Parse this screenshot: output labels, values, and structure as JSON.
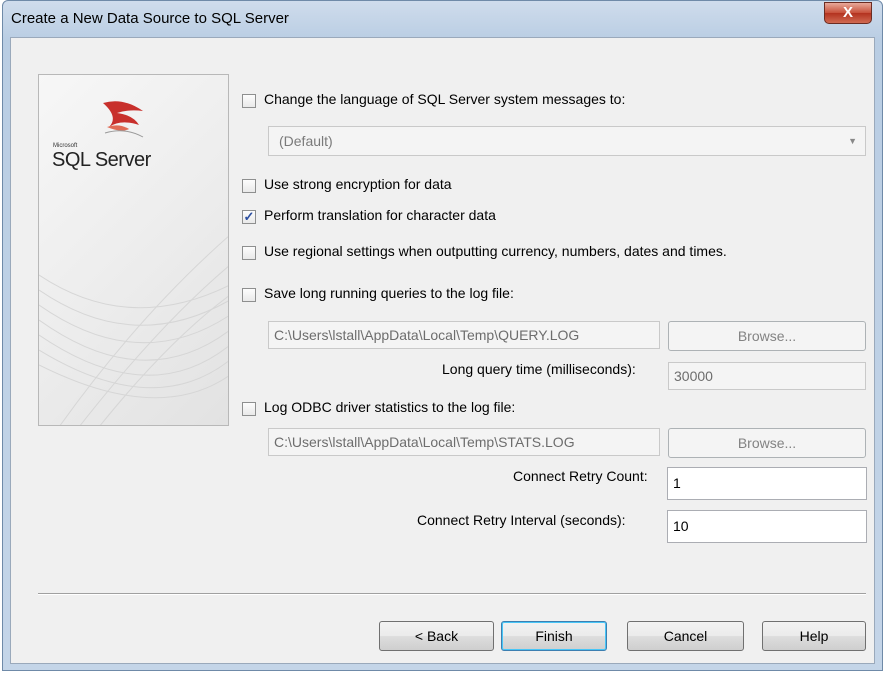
{
  "window": {
    "title": "Create a New Data Source to SQL Server",
    "close_glyph": "X"
  },
  "logo": {
    "small_text": "Microsoft",
    "product_text": "SQL Server"
  },
  "options": {
    "change_language": {
      "label": "Change the language of SQL Server system messages to:",
      "checked": false
    },
    "language_select": {
      "value": "(Default)"
    },
    "strong_encryption": {
      "label": "Use strong encryption for data",
      "checked": false
    },
    "perform_translation": {
      "label": "Perform translation for character data",
      "checked": true
    },
    "regional_settings": {
      "label": "Use regional settings when outputting currency, numbers, dates and times.",
      "checked": false
    },
    "save_long_queries": {
      "label": "Save long running queries to the log file:",
      "checked": false
    },
    "query_log_path": "C:\\Users\\lstall\\AppData\\Local\\Temp\\QUERY.LOG",
    "query_browse_label": "Browse...",
    "long_query_time_label": "Long query time (milliseconds):",
    "long_query_time_value": "30000",
    "log_odbc_stats": {
      "label": "Log ODBC driver statistics to the log file:",
      "checked": false
    },
    "stats_log_path": "C:\\Users\\lstall\\AppData\\Local\\Temp\\STATS.LOG",
    "stats_browse_label": "Browse...",
    "connect_retry_count_label": "Connect Retry Count:",
    "connect_retry_count_value": "1",
    "connect_retry_interval_label": "Connect Retry Interval (seconds):",
    "connect_retry_interval_value": "10"
  },
  "buttons": {
    "back": "< Back",
    "finish": "Finish",
    "cancel": "Cancel",
    "help": "Help"
  },
  "icons": {
    "checkmark": "✓",
    "dropdown": "chevron-down-icon"
  }
}
